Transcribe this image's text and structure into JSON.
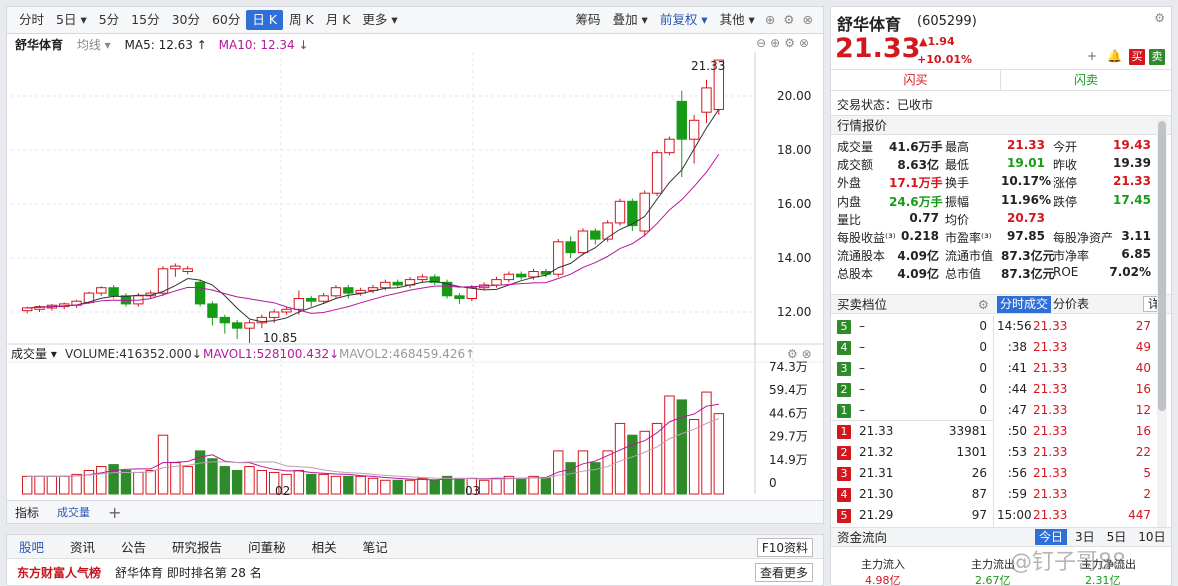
{
  "toolbar": {
    "left": [
      "分时",
      "5日 ▾",
      "5分",
      "15分",
      "30分",
      "60分",
      "日 K",
      "周 K",
      "月 K",
      "更多 ▾"
    ],
    "active": "日 K",
    "right": [
      "筹码",
      "叠加 ▾",
      "前复权 ▾",
      "其他 ▾"
    ]
  },
  "legend": {
    "name": "舒华体育",
    "line": "均线 ▾",
    "ma5": "MA5: 12.63 ↑",
    "ma10": "MA10: 12.34 ↓"
  },
  "price_axis": [
    "20.00",
    "18.00",
    "16.00",
    "14.00",
    "12.00"
  ],
  "annot": {
    "high": "21.33",
    "low": "10.85"
  },
  "vol_legend": {
    "name": "成交量 ▾",
    "vol": "VOLUME:416352.000↓",
    "mavol1": "MAVOL1:528100.432↓",
    "mavol2": "MAVOL2:468459.426↑"
  },
  "vol_axis": [
    "74.3万",
    "59.4万",
    "44.6万",
    "29.7万",
    "14.9万",
    "0"
  ],
  "x_labels": [
    "02",
    "03"
  ],
  "bottom_tabs": [
    "指标",
    "成交量",
    "+"
  ],
  "news": {
    "tabs": [
      "股吧",
      "资讯",
      "公告",
      "研究报告",
      "问董秘",
      "相关",
      "笔记"
    ],
    "f10": "F10资料",
    "brand": "东方财富人气榜",
    "text": "舒华体育  即时排名第 28 名",
    "more": "查看更多"
  },
  "stock": {
    "name": "舒华体育",
    "code": "(605299)",
    "price": "21.33",
    "chg": "1.94",
    "pct": "+10.01%",
    "btn_buy": "买",
    "btn_sell": "卖",
    "flash_buy": "闪买",
    "flash_sell": "闪卖",
    "status": "交易状态：已收市",
    "quote_title": "行情报价"
  },
  "quote": [
    [
      "成交量",
      "41.6万手",
      "最高",
      "21.33",
      "今开",
      "19.43"
    ],
    [
      "成交额",
      "8.63亿",
      "最低",
      "19.01",
      "昨收",
      "19.39"
    ],
    [
      "外盘",
      "17.1万手",
      "换手",
      "10.17%",
      "涨停",
      "21.33"
    ],
    [
      "内盘",
      "24.6万手",
      "振幅",
      "11.96%",
      "跌停",
      "17.45"
    ],
    [
      "量比",
      "0.77",
      "均价",
      "20.73",
      "",
      ""
    ],
    [
      "每股收益⁽³⁾",
      "0.218",
      "市盈率⁽³⁾",
      "97.85",
      "每股净资产",
      "3.11"
    ],
    [
      "流通股本",
      "4.09亿",
      "流通市值",
      "87.3亿元",
      "市净率",
      "6.85"
    ],
    [
      "总股本",
      "4.09亿",
      "总市值",
      "87.3亿元",
      "ROE",
      "7.02%"
    ]
  ],
  "orderbook_title": "买卖档位",
  "tick_tab": "分时成交",
  "fenjia_tab": "分价表",
  "detail": "详",
  "sells": [
    [
      "5",
      "–",
      "0"
    ],
    [
      "4",
      "–",
      "0"
    ],
    [
      "3",
      "–",
      "0"
    ],
    [
      "2",
      "–",
      "0"
    ],
    [
      "1",
      "–",
      "0"
    ]
  ],
  "buys": [
    [
      "1",
      "21.33",
      "33981"
    ],
    [
      "2",
      "21.32",
      "1301"
    ],
    [
      "3",
      "21.31",
      "26"
    ],
    [
      "4",
      "21.30",
      "87"
    ],
    [
      "5",
      "21.29",
      "97"
    ]
  ],
  "ticks": [
    [
      "14:56",
      "21.33",
      "27"
    ],
    [
      ":38",
      "21.33",
      "49"
    ],
    [
      ":41",
      "21.33",
      "40"
    ],
    [
      ":44",
      "21.33",
      "16"
    ],
    [
      ":47",
      "21.33",
      "12"
    ],
    [
      ":50",
      "21.33",
      "16"
    ],
    [
      ":53",
      "21.33",
      "22"
    ],
    [
      ":56",
      "21.33",
      "5"
    ],
    [
      ":59",
      "21.33",
      "2"
    ],
    [
      "15:00",
      "21.33",
      "447"
    ]
  ],
  "flow": {
    "title": "资金流向",
    "tabs": [
      "今日",
      "3日",
      "5日",
      "10日"
    ],
    "items": [
      [
        "主力流入",
        "4.98亿"
      ],
      [
        "主力流出",
        "2.67亿"
      ],
      [
        "主力净流出",
        "2.31亿"
      ]
    ]
  },
  "watermark": "@钉子哥88"
}
